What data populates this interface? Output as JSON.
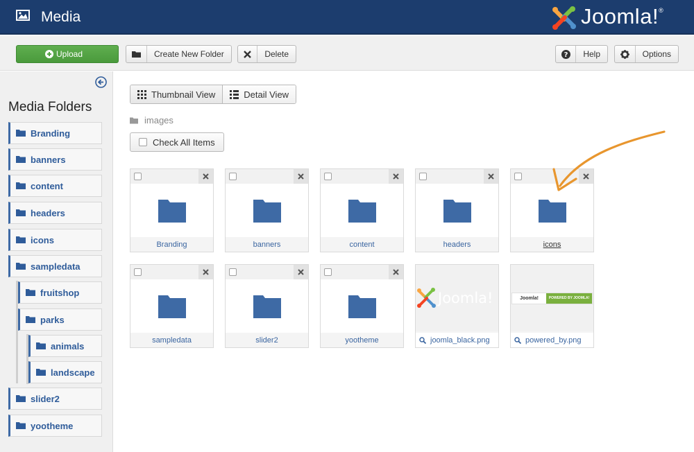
{
  "header": {
    "title": "Media",
    "brand": "Joomla!",
    "brand_name": "Joomla",
    "brand_mark": "!",
    "brand_reg": "®"
  },
  "toolbar": {
    "upload_label": "Upload",
    "new_folder_label": "Create New Folder",
    "delete_label": "Delete",
    "help_label": "Help",
    "options_label": "Options"
  },
  "sidebar": {
    "title": "Media Folders",
    "folders": [
      {
        "label": "Branding"
      },
      {
        "label": "banners"
      },
      {
        "label": "content"
      },
      {
        "label": "headers"
      },
      {
        "label": "icons"
      },
      {
        "label": "sampledata"
      },
      {
        "label": "fruitshop"
      },
      {
        "label": "parks"
      },
      {
        "label": "animals"
      },
      {
        "label": "landscape"
      },
      {
        "label": "slider2"
      },
      {
        "label": "yootheme"
      }
    ]
  },
  "main": {
    "views": {
      "thumbnail": "Thumbnail View",
      "detail": "Detail View"
    },
    "path": "images",
    "check_all": "Check All Items",
    "items": [
      {
        "name": "Branding",
        "type": "folder"
      },
      {
        "name": "banners",
        "type": "folder"
      },
      {
        "name": "content",
        "type": "folder"
      },
      {
        "name": "headers",
        "type": "folder"
      },
      {
        "name": "icons",
        "type": "folder",
        "hovered": true
      },
      {
        "name": "sampledata",
        "type": "folder"
      },
      {
        "name": "slider2",
        "type": "folder"
      },
      {
        "name": "yootheme",
        "type": "folder"
      },
      {
        "name": "joomla_black.png",
        "type": "image"
      },
      {
        "name": "powered_by.png",
        "type": "image"
      }
    ],
    "powered_by_left": "Joomla!",
    "powered_by_right": "POWERED BY JOOMLA!"
  },
  "colors": {
    "header_bg": "#1c3d6e",
    "upload_green": "#52a343",
    "folder_blue": "#3e6aa5",
    "annotation_arrow": "#e8962e"
  }
}
